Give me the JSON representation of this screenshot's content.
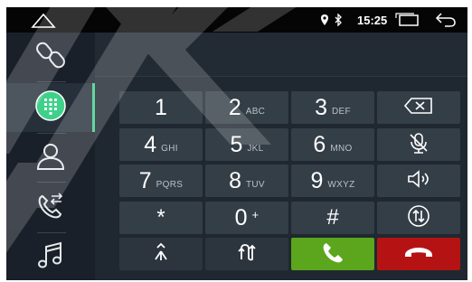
{
  "status": {
    "time": "15:25",
    "icons": [
      "home-icon",
      "location-icon",
      "bluetooth-icon",
      "recent-apps-icon",
      "back-icon"
    ]
  },
  "sidebar": {
    "items": [
      {
        "name": "bluetooth-link",
        "icon": "link-icon"
      },
      {
        "name": "dialpad",
        "icon": "dialpad-icon",
        "active": true
      },
      {
        "name": "contacts",
        "icon": "contact-icon"
      },
      {
        "name": "call-log",
        "icon": "call-transfer-icon"
      },
      {
        "name": "music",
        "icon": "music-icon"
      }
    ]
  },
  "dialpad": {
    "keys": [
      {
        "digit": "1",
        "letters": ""
      },
      {
        "digit": "2",
        "letters": "ABC"
      },
      {
        "digit": "3",
        "letters": "DEF"
      },
      {
        "digit": "4",
        "letters": "GHI"
      },
      {
        "digit": "5",
        "letters": "JKL"
      },
      {
        "digit": "6",
        "letters": "MNO"
      },
      {
        "digit": "7",
        "letters": "PQRS"
      },
      {
        "digit": "8",
        "letters": "TUV"
      },
      {
        "digit": "9",
        "letters": "WXYZ"
      },
      {
        "digit": "*",
        "letters": ""
      },
      {
        "digit": "0",
        "letters": "+"
      },
      {
        "digit": "#",
        "letters": ""
      }
    ],
    "function_icons": [
      "backspace-icon",
      "mic-mute-icon",
      "speaker-icon",
      "swap-icon",
      "merge-call-icon",
      "switch-icon",
      "call-icon",
      "hang-up-icon"
    ],
    "colors": {
      "call": "#5ba61c",
      "end": "#b51313",
      "accent": "#3fd08a"
    }
  }
}
